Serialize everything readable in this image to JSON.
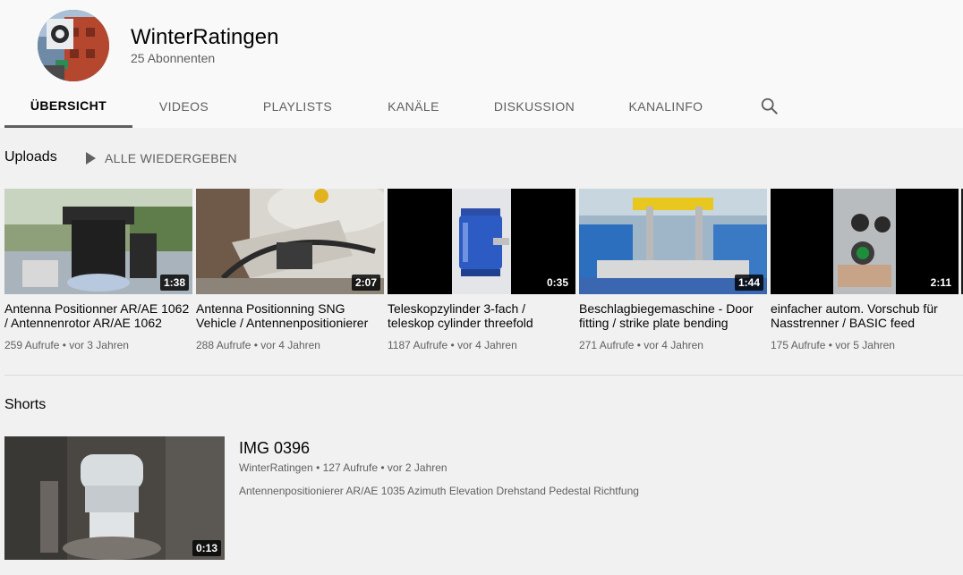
{
  "channel": {
    "name": "WinterRatingen",
    "subscribers": "25 Abonnenten"
  },
  "tabs": [
    {
      "label": "ÜBERSICHT",
      "active": true
    },
    {
      "label": "VIDEOS"
    },
    {
      "label": "PLAYLISTS"
    },
    {
      "label": "KANÄLE"
    },
    {
      "label": "DISKUSSION"
    },
    {
      "label": "KANALINFO"
    }
  ],
  "search_icon": "search-icon",
  "uploads": {
    "title": "Uploads",
    "play_all": "ALLE WIEDERGEBEN",
    "videos": [
      {
        "title": "Antenna Positionner AR/AE 1062 / Antennenrotor AR/AE 1062",
        "duration": "1:38",
        "views": "259 Aufrufe",
        "age": "vor 3 Jahren"
      },
      {
        "title": "Antenna Positionning SNG Vehicle / Antennenpositionierer",
        "duration": "2:07",
        "views": "288 Aufrufe",
        "age": "vor 4 Jahren"
      },
      {
        "title": "Teleskopzylinder 3-fach / teleskop cylinder threefold",
        "duration": "0:35",
        "views": "1187 Aufrufe",
        "age": "vor 4 Jahren"
      },
      {
        "title": "Beschlagbiegemaschine - Door fitting / strike plate bending",
        "duration": "1:44",
        "views": "271 Aufrufe",
        "age": "vor 4 Jahren"
      },
      {
        "title": "einfacher autom. Vorschub für Nasstrenner / BASIC feed",
        "duration": "2:11",
        "views": "175 Aufrufe",
        "age": "vor 5 Jahren"
      }
    ]
  },
  "shorts": {
    "title": "Shorts",
    "item": {
      "title": "IMG 0396",
      "channel": "WinterRatingen",
      "views": "127 Aufrufe",
      "age": "vor 2 Jahren",
      "duration": "0:13",
      "description": "Antennenpositionierer AR/AE 1035 Azimuth Elevation Drehstand Pedestal Richtfung"
    }
  },
  "meta_separator": "•"
}
